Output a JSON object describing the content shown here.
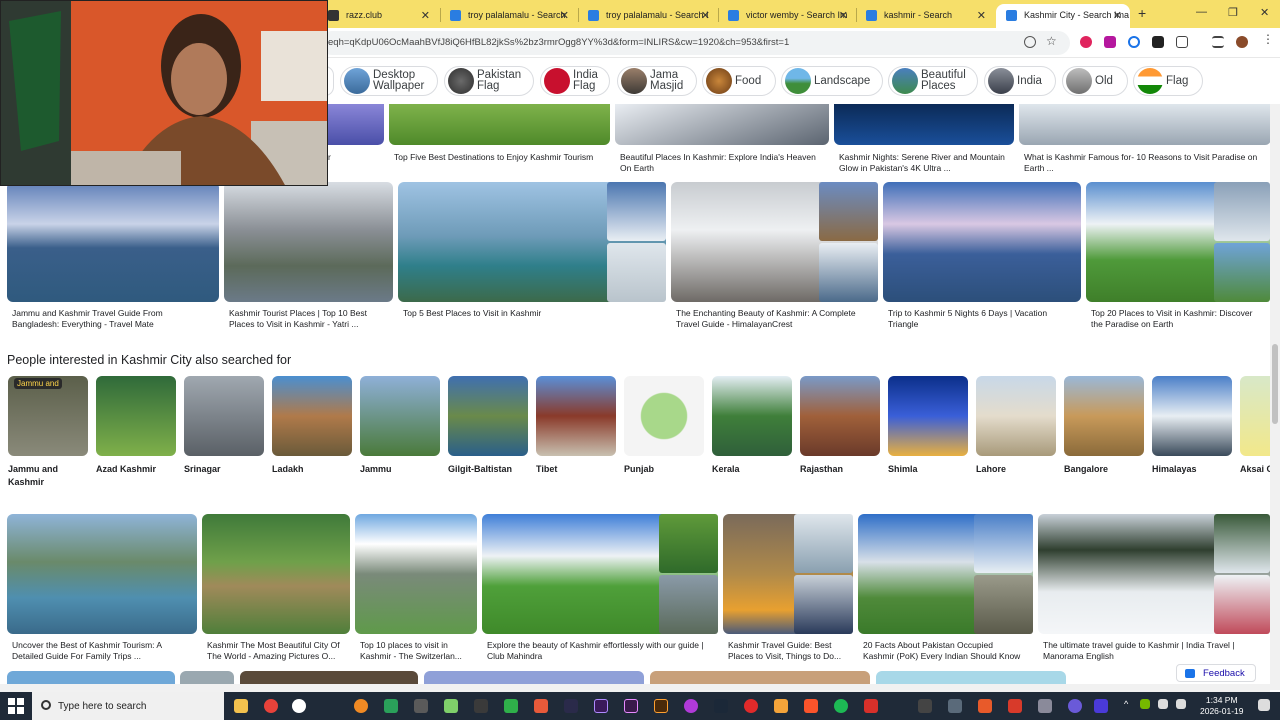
{
  "tabs": [
    {
      "title": "razz.club"
    },
    {
      "title": "troy palalamalu - Search"
    },
    {
      "title": "troy palalamalu - Search I"
    },
    {
      "title": "victor wemby - Search Im"
    },
    {
      "title": "kashmir - Search"
    },
    {
      "title": "Kashmir City - Search Ima"
    }
  ],
  "url": "eqh=qKdpU06OcMaahBVfJ8iQ6HfBL82jkSs%2bz3rmrOgg8YY%3d&form=INLIRS&cw=1920&ch=953&first=1",
  "chips": [
    {
      "label": "Desktop\nWallpaper",
      "l1": "Desktop",
      "l2": "Wallpaper"
    },
    {
      "l1": "Pakistan",
      "l2": "Flag"
    },
    {
      "l1": "India",
      "l2": "Flag"
    },
    {
      "l1": "Jama",
      "l2": "Masjid"
    },
    {
      "l1": "Food",
      "l2": ""
    },
    {
      "l1": "Landscape",
      "l2": ""
    },
    {
      "l1": "Beautiful",
      "l2": "Places"
    },
    {
      "l1": "India",
      "l2": ""
    },
    {
      "l1": "Old",
      "l2": ""
    },
    {
      "l1": "Flag",
      "l2": ""
    }
  ],
  "row1": [
    {
      "c1": "r",
      "c2": ""
    },
    {
      "c1": "Top Five Best Destinations to Enjoy Kashmir Tourism",
      "c2": ""
    },
    {
      "c1": "Beautiful Places In Kashmir: Explore India's Heaven",
      "c2": "On Earth"
    },
    {
      "c1": "Kashmir Nights: Serene River and Mountain",
      "c2": "Glow in Pakistan's 4K Ultra ..."
    },
    {
      "c1": "What is Kashmir Famous for- 10 Reasons to Visit Paradise on",
      "c2": "Earth ..."
    }
  ],
  "row2": [
    {
      "c1": "Jammu and Kashmir Travel Guide From",
      "c2": "Bangladesh: Everything - Travel Mate"
    },
    {
      "c1": "Kashmir Tourist Places | Top 10 Best",
      "c2": "Places to Visit in Kashmir - Yatri ..."
    },
    {
      "c1": "Top 5 Best Places to Visit in Kashmir",
      "c2": ""
    },
    {
      "c1": "The Enchanting Beauty of Kashmir: A Complete",
      "c2": "Travel Guide - HimalayanCrest"
    },
    {
      "c1": "Trip to Kashmir 5 Nights 6 Days | Vacation",
      "c2": "Triangle"
    },
    {
      "c1": "Top 20 Places to Visit in Kashmir: Discover",
      "c2": "the Paradise on Earth"
    }
  ],
  "related_heading": "People interested in Kashmir City also searched for",
  "related": [
    {
      "l1": "Jammu and",
      "l2": "Kashmir",
      "badge": "Jammu and"
    },
    {
      "l1": "Azad Kashmir",
      "l2": ""
    },
    {
      "l1": "Srinagar",
      "l2": ""
    },
    {
      "l1": "Ladakh",
      "l2": ""
    },
    {
      "l1": "Jammu",
      "l2": ""
    },
    {
      "l1": "Gilgit-Baltistan",
      "l2": ""
    },
    {
      "l1": "Tibet",
      "l2": ""
    },
    {
      "l1": "Punjab",
      "l2": ""
    },
    {
      "l1": "Kerala",
      "l2": ""
    },
    {
      "l1": "Rajasthan",
      "l2": ""
    },
    {
      "l1": "Shimla",
      "l2": ""
    },
    {
      "l1": "Lahore",
      "l2": ""
    },
    {
      "l1": "Bangalore",
      "l2": ""
    },
    {
      "l1": "Himalayas",
      "l2": ""
    },
    {
      "l1": "Aksai C",
      "l2": ""
    }
  ],
  "row3": [
    {
      "c1": "Uncover the Best of Kashmir Tourism: A",
      "c2": "Detailed Guide For Family Trips ..."
    },
    {
      "c1": "Kashmir The Most Beautiful City Of",
      "c2": "The World - Amazing Pictures O..."
    },
    {
      "c1": "Top 10 places to visit in",
      "c2": "Kashmir - The Switzerlan..."
    },
    {
      "c1": "Explore the beauty of Kashmir effortlessly with our guide |",
      "c2": "Club Mahindra"
    },
    {
      "c1": "Kashmir Travel Guide: Best",
      "c2": "Places to Visit, Things to Do..."
    },
    {
      "c1": "20 Facts About Pakistan Occupied",
      "c2": "Kashmir (PoK) Every Indian Should Know"
    },
    {
      "c1": "The ultimate travel guide to Kashmir | India Travel |",
      "c2": "Manorama English"
    }
  ],
  "feedback": "Feedback",
  "taskbar": {
    "search_placeholder": "Type here to search",
    "time": "1:34 PM",
    "date": "2026-01-19"
  },
  "colors": {
    "tabbar": "#f6df6a",
    "taskbar": "#1f2a38",
    "link": "#1a0dab"
  }
}
